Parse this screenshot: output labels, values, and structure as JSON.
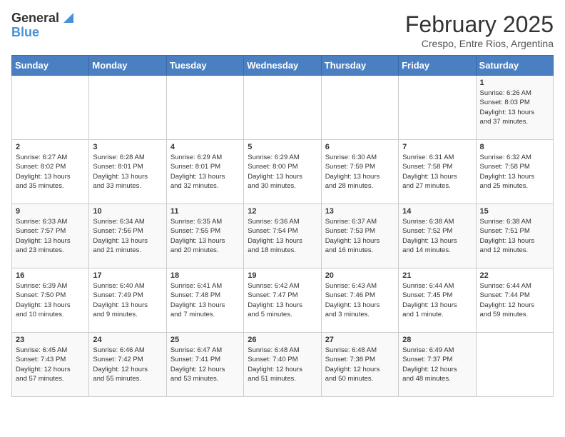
{
  "logo": {
    "line1": "General",
    "line2": "Blue"
  },
  "title": "February 2025",
  "subtitle": "Crespo, Entre Rios, Argentina",
  "days_of_week": [
    "Sunday",
    "Monday",
    "Tuesday",
    "Wednesday",
    "Thursday",
    "Friday",
    "Saturday"
  ],
  "weeks": [
    [
      {
        "day": "",
        "info": ""
      },
      {
        "day": "",
        "info": ""
      },
      {
        "day": "",
        "info": ""
      },
      {
        "day": "",
        "info": ""
      },
      {
        "day": "",
        "info": ""
      },
      {
        "day": "",
        "info": ""
      },
      {
        "day": "1",
        "info": "Sunrise: 6:26 AM\nSunset: 8:03 PM\nDaylight: 13 hours\nand 37 minutes."
      }
    ],
    [
      {
        "day": "2",
        "info": "Sunrise: 6:27 AM\nSunset: 8:02 PM\nDaylight: 13 hours\nand 35 minutes."
      },
      {
        "day": "3",
        "info": "Sunrise: 6:28 AM\nSunset: 8:01 PM\nDaylight: 13 hours\nand 33 minutes."
      },
      {
        "day": "4",
        "info": "Sunrise: 6:29 AM\nSunset: 8:01 PM\nDaylight: 13 hours\nand 32 minutes."
      },
      {
        "day": "5",
        "info": "Sunrise: 6:29 AM\nSunset: 8:00 PM\nDaylight: 13 hours\nand 30 minutes."
      },
      {
        "day": "6",
        "info": "Sunrise: 6:30 AM\nSunset: 7:59 PM\nDaylight: 13 hours\nand 28 minutes."
      },
      {
        "day": "7",
        "info": "Sunrise: 6:31 AM\nSunset: 7:58 PM\nDaylight: 13 hours\nand 27 minutes."
      },
      {
        "day": "8",
        "info": "Sunrise: 6:32 AM\nSunset: 7:58 PM\nDaylight: 13 hours\nand 25 minutes."
      }
    ],
    [
      {
        "day": "9",
        "info": "Sunrise: 6:33 AM\nSunset: 7:57 PM\nDaylight: 13 hours\nand 23 minutes."
      },
      {
        "day": "10",
        "info": "Sunrise: 6:34 AM\nSunset: 7:56 PM\nDaylight: 13 hours\nand 21 minutes."
      },
      {
        "day": "11",
        "info": "Sunrise: 6:35 AM\nSunset: 7:55 PM\nDaylight: 13 hours\nand 20 minutes."
      },
      {
        "day": "12",
        "info": "Sunrise: 6:36 AM\nSunset: 7:54 PM\nDaylight: 13 hours\nand 18 minutes."
      },
      {
        "day": "13",
        "info": "Sunrise: 6:37 AM\nSunset: 7:53 PM\nDaylight: 13 hours\nand 16 minutes."
      },
      {
        "day": "14",
        "info": "Sunrise: 6:38 AM\nSunset: 7:52 PM\nDaylight: 13 hours\nand 14 minutes."
      },
      {
        "day": "15",
        "info": "Sunrise: 6:38 AM\nSunset: 7:51 PM\nDaylight: 13 hours\nand 12 minutes."
      }
    ],
    [
      {
        "day": "16",
        "info": "Sunrise: 6:39 AM\nSunset: 7:50 PM\nDaylight: 13 hours\nand 10 minutes."
      },
      {
        "day": "17",
        "info": "Sunrise: 6:40 AM\nSunset: 7:49 PM\nDaylight: 13 hours\nand 9 minutes."
      },
      {
        "day": "18",
        "info": "Sunrise: 6:41 AM\nSunset: 7:48 PM\nDaylight: 13 hours\nand 7 minutes."
      },
      {
        "day": "19",
        "info": "Sunrise: 6:42 AM\nSunset: 7:47 PM\nDaylight: 13 hours\nand 5 minutes."
      },
      {
        "day": "20",
        "info": "Sunrise: 6:43 AM\nSunset: 7:46 PM\nDaylight: 13 hours\nand 3 minutes."
      },
      {
        "day": "21",
        "info": "Sunrise: 6:44 AM\nSunset: 7:45 PM\nDaylight: 13 hours\nand 1 minute."
      },
      {
        "day": "22",
        "info": "Sunrise: 6:44 AM\nSunset: 7:44 PM\nDaylight: 12 hours\nand 59 minutes."
      }
    ],
    [
      {
        "day": "23",
        "info": "Sunrise: 6:45 AM\nSunset: 7:43 PM\nDaylight: 12 hours\nand 57 minutes."
      },
      {
        "day": "24",
        "info": "Sunrise: 6:46 AM\nSunset: 7:42 PM\nDaylight: 12 hours\nand 55 minutes."
      },
      {
        "day": "25",
        "info": "Sunrise: 6:47 AM\nSunset: 7:41 PM\nDaylight: 12 hours\nand 53 minutes."
      },
      {
        "day": "26",
        "info": "Sunrise: 6:48 AM\nSunset: 7:40 PM\nDaylight: 12 hours\nand 51 minutes."
      },
      {
        "day": "27",
        "info": "Sunrise: 6:48 AM\nSunset: 7:38 PM\nDaylight: 12 hours\nand 50 minutes."
      },
      {
        "day": "28",
        "info": "Sunrise: 6:49 AM\nSunset: 7:37 PM\nDaylight: 12 hours\nand 48 minutes."
      },
      {
        "day": "",
        "info": ""
      }
    ]
  ]
}
